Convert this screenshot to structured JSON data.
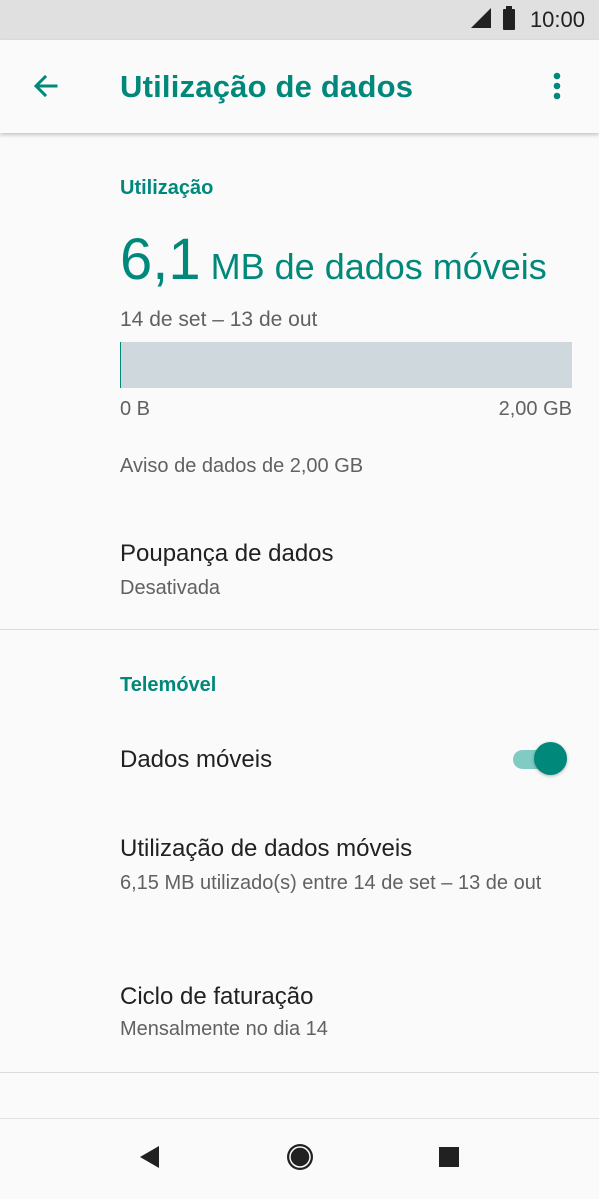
{
  "status_bar": {
    "time": "10:00",
    "signal_icon": "cell-signal-icon",
    "battery_icon": "battery-icon"
  },
  "app_bar": {
    "title": "Utilização de dados",
    "back_icon": "arrow-back-icon",
    "overflow_icon": "more-vert-icon"
  },
  "usage": {
    "section_label": "Utilização",
    "amount": "6,1",
    "unit_label": "MB de dados móveis",
    "cycle_range": "14 de set – 13 de out",
    "bar_min_label": "0 B",
    "bar_max_label": "2,00 GB",
    "bar_fraction": 0.003,
    "warning": "Aviso de dados de 2,00 GB"
  },
  "data_saver": {
    "title": "Poupança de dados",
    "summary": "Desativada"
  },
  "mobile": {
    "section_label": "Telemóvel",
    "mobile_data": {
      "title": "Dados móveis",
      "enabled": true
    },
    "mobile_usage": {
      "title": "Utilização de dados móveis",
      "summary": "6,15 MB utilizado(s) entre 14 de set – 13 de out"
    },
    "billing_cycle": {
      "title": "Ciclo de faturação",
      "summary": "Mensalmente no dia 14"
    }
  },
  "nav_bar": {
    "back_icon": "nav-back-icon",
    "home_icon": "nav-home-icon",
    "recents_icon": "nav-recents-icon"
  },
  "colors": {
    "accent": "#00897b",
    "bar_track": "#cfd8dc",
    "toggle_track": "#80cbc4"
  }
}
